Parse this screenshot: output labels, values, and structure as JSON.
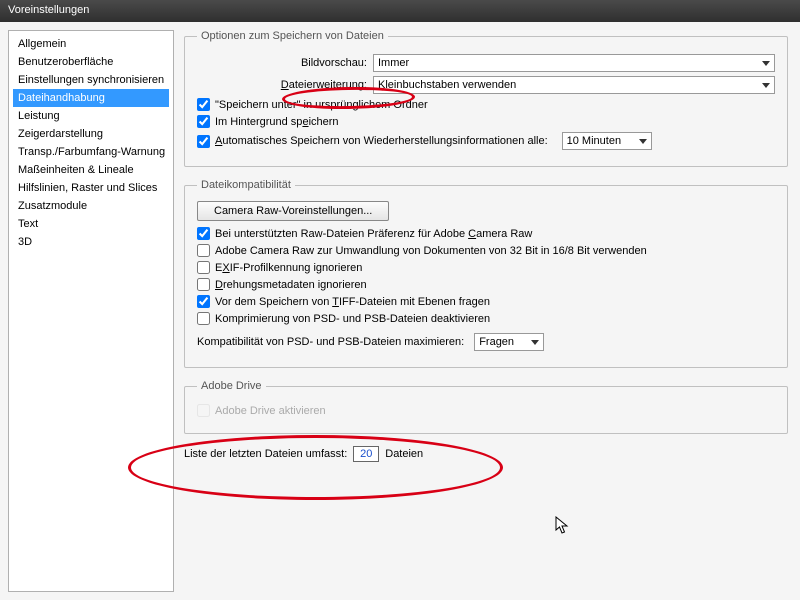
{
  "title": "Voreinstellungen",
  "sidebar": {
    "items": [
      "Allgemein",
      "Benutzeroberfläche",
      "Einstellungen synchronisieren",
      "Dateihandhabung",
      "Leistung",
      "Zeigerdarstellung",
      "Transp./Farbumfang-Warnung",
      "Maßeinheiten & Lineale",
      "Hilfslinien, Raster und Slices",
      "Zusatzmodule",
      "Text",
      "3D"
    ],
    "selected_index": 3
  },
  "save_group": {
    "legend": "Optionen zum Speichern von Dateien",
    "preview_label": "Bildvorschau:",
    "preview_value": "Immer",
    "ext_label_pre": "Dateierweiterung:",
    "ext_value": "Kleinbuchstaben verwenden",
    "chk_saveas": "\"Speichern unter\" in ursprünglichem Ordner",
    "chk_bg": "Im Hintergrund speichern",
    "chk_auto_pre": "Automatisches Speichern von Wiederherstellungsinformationen alle:",
    "auto_interval": "10 Minuten"
  },
  "compat_group": {
    "legend": "Dateikompatibilität",
    "btn_camera": "Camera Raw-Voreinstellungen...",
    "chk_raw_pref": "Bei unterstützten Raw-Dateien Präferenz für Adobe Camera Raw",
    "chk_32to16": "Adobe Camera Raw zur Umwandlung von Dokumenten von 32 Bit in 16/8 Bit verwenden",
    "chk_exif": "EXIF-Profilkennung ignorieren",
    "chk_rot": "Drehungsmetadaten ignorieren",
    "chk_tiff": "Vor dem Speichern von TIFF-Dateien mit Ebenen fragen",
    "chk_psd_comp": "Komprimierung von PSD- und PSB-Dateien deaktivieren",
    "max_label": "Kompatibilität von PSD- und PSB-Dateien maximieren:",
    "max_value": "Fragen"
  },
  "drive_group": {
    "legend": "Adobe Drive",
    "chk_drive": "Adobe Drive aktivieren"
  },
  "recent": {
    "pre": "Liste der letzten Dateien umfasst:",
    "value": "20",
    "post": "Dateien"
  }
}
